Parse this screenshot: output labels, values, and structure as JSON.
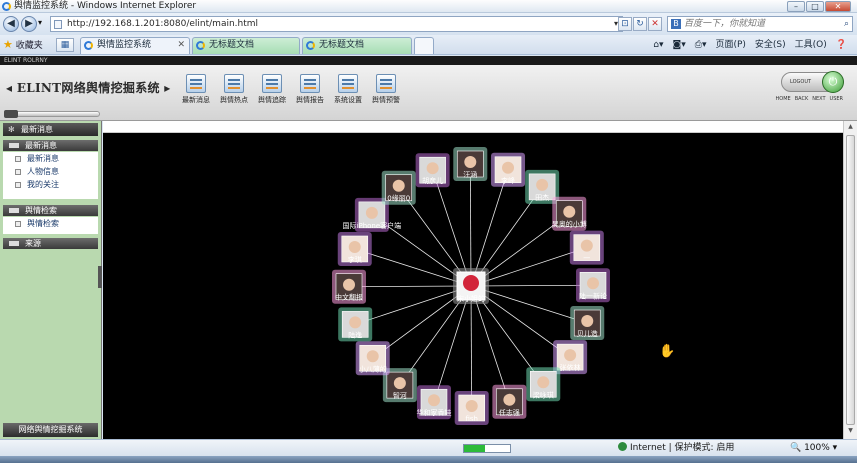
{
  "window": {
    "title": "舆情监控系统 - Windows Internet Explorer"
  },
  "toolbar": {
    "url": "http://192.168.1.201:8080/elint/main.html",
    "search_placeholder": "百度一下，你就知道",
    "favorites": "收藏夹",
    "tabs": [
      {
        "label": "舆情监控系统"
      },
      {
        "label": "无标题文档"
      },
      {
        "label": "无标题文档"
      }
    ],
    "commands": [
      "页面(P)",
      "安全(S)",
      "工具(O)"
    ]
  },
  "header": {
    "strip": "ELINT ROLRNY",
    "title": "ELINT网络舆情挖掘系统",
    "nav": [
      {
        "label": "最新消息",
        "icon": "news-icon"
      },
      {
        "label": "舆情热点",
        "icon": "hotspot-icon"
      },
      {
        "label": "舆情追踪",
        "icon": "tracking-icon"
      },
      {
        "label": "舆情报告",
        "icon": "report-icon"
      },
      {
        "label": "系统设置",
        "icon": "settings-icon"
      },
      {
        "label": "舆情预警",
        "icon": "warning-icon"
      }
    ],
    "logout": "LOGOUT",
    "links": [
      "HOME",
      "BACK",
      "NEXT",
      "USER"
    ]
  },
  "sidebar": {
    "top": "最新消息",
    "sections": [
      {
        "title": "最新消息",
        "items": [
          "最新消息",
          "人物信息",
          "我的关注"
        ]
      },
      {
        "title": "舆情检索",
        "items": [
          "舆情检索"
        ]
      },
      {
        "title": "来源",
        "items": []
      }
    ],
    "footer": "网络舆情挖掘系统"
  },
  "graph": {
    "center": "宋小姐的",
    "nodes": [
      "胡彦儿",
      "汪涵",
      "李峰",
      "田杰",
      "吴奥的小博",
      "一",
      "陆一新论",
      "贝儿造",
      "张依林",
      "梁咏琪",
      "任志强",
      "fish",
      "华和家香娃",
      "智河",
      "小八薄的",
      "陆逸",
      "中文翻报",
      "李琪",
      "国际iPhone客户端",
      "0缘丽0"
    ]
  },
  "status": {
    "zone": "Internet | 保护模式: 启用",
    "zoom": "100%",
    "progress": 0.45
  }
}
